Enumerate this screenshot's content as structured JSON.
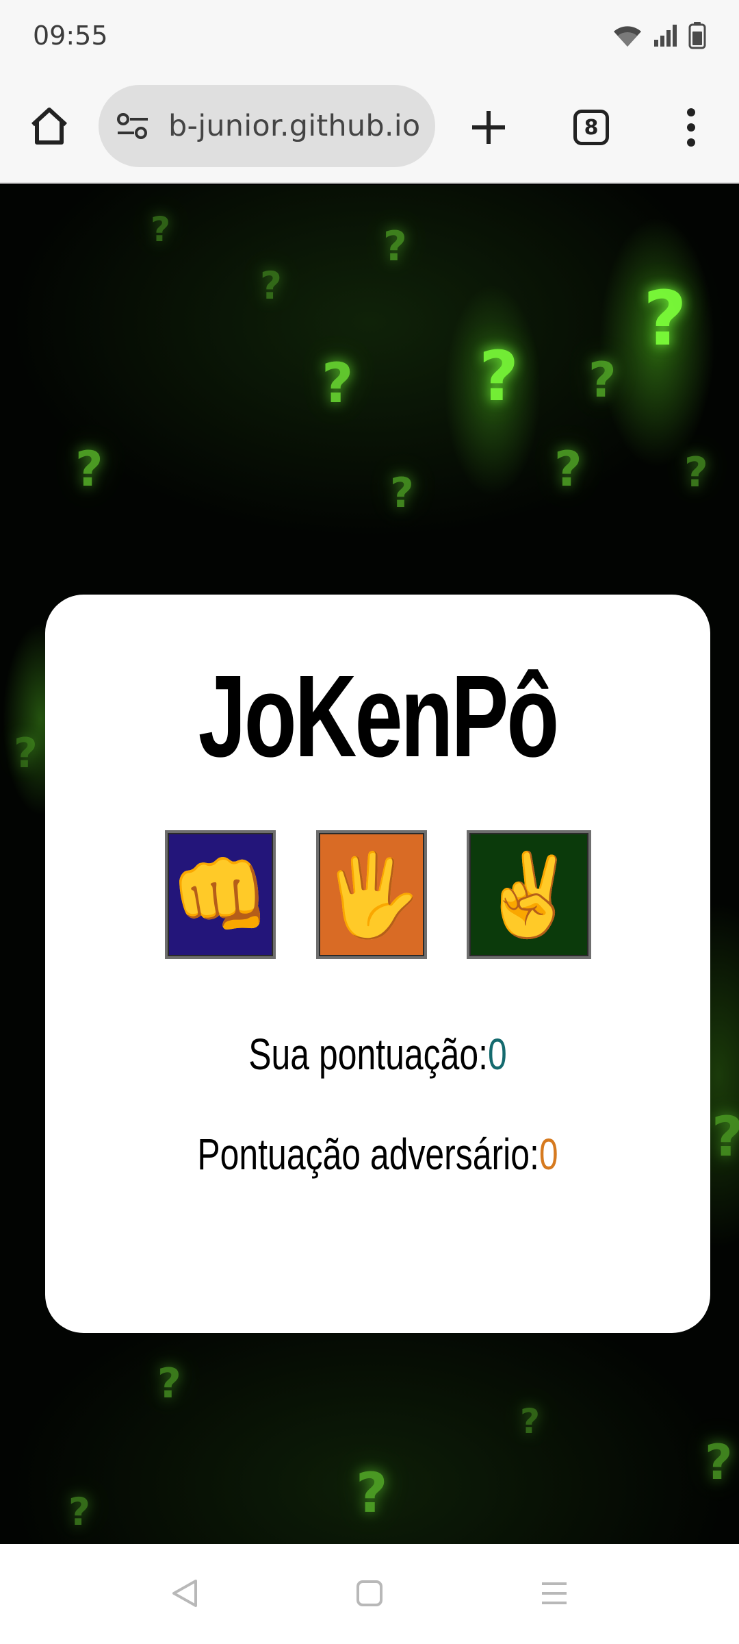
{
  "status_bar": {
    "time": "09:55"
  },
  "browser": {
    "url": "b-junior.github.io",
    "tab_count": "8"
  },
  "game": {
    "title": "JoKenPô",
    "choices": [
      {
        "name": "pedra",
        "emoji": "👊",
        "color": "#23157a"
      },
      {
        "name": "papel",
        "emoji": "🖐️",
        "color": "#d96b25"
      },
      {
        "name": "tesoura",
        "emoji": "✌️",
        "color": "#0b3a0b"
      }
    ],
    "score_label_you": "Sua pontuação:",
    "score_you": "0",
    "score_label_opponent": "Pontuação adversário:",
    "score_opponent": "0"
  },
  "colors": {
    "score_you": "#146a6e",
    "score_opponent": "#d67a1f",
    "glow": "#7cff3a"
  }
}
